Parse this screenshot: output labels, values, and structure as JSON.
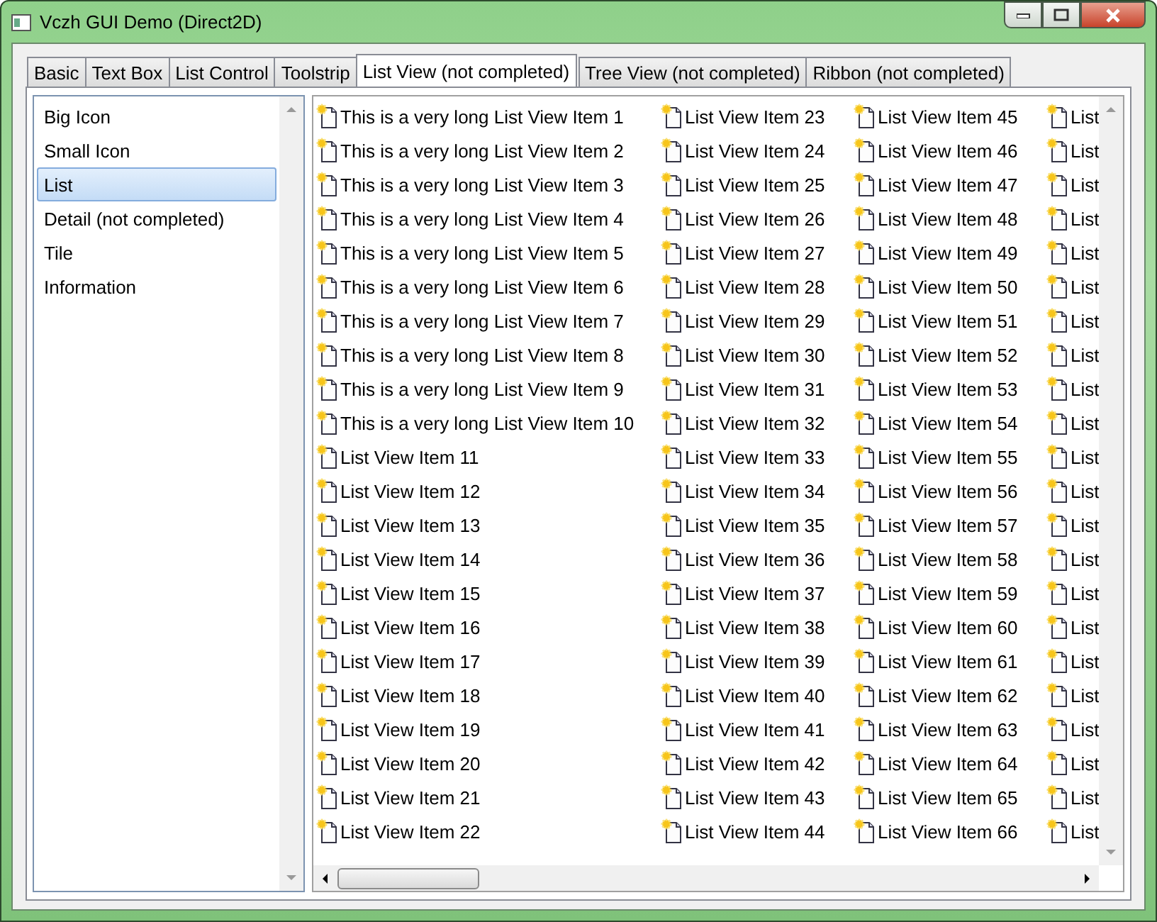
{
  "window": {
    "title": "Vczh GUI Demo (Direct2D)"
  },
  "tabs": [
    {
      "label": "Basic",
      "selected": false
    },
    {
      "label": "Text Box",
      "selected": false
    },
    {
      "label": "List Control",
      "selected": false
    },
    {
      "label": "Toolstrip",
      "selected": false
    },
    {
      "label": "List View (not completed)",
      "selected": true
    },
    {
      "label": "Tree View (not completed)",
      "selected": false
    },
    {
      "label": "Ribbon (not completed)",
      "selected": false
    }
  ],
  "view_modes": [
    {
      "label": "Big Icon",
      "selected": false
    },
    {
      "label": "Small Icon",
      "selected": false
    },
    {
      "label": "List",
      "selected": true
    },
    {
      "label": "Detail (not completed)",
      "selected": false
    },
    {
      "label": "Tile",
      "selected": false
    },
    {
      "label": "Information",
      "selected": false
    }
  ],
  "list_view": {
    "columns": [
      [
        "This is a very long List View Item 1",
        "This is a very long List View Item 2",
        "This is a very long List View Item 3",
        "This is a very long List View Item 4",
        "This is a very long List View Item 5",
        "This is a very long List View Item 6",
        "This is a very long List View Item 7",
        "This is a very long List View Item 8",
        "This is a very long List View Item 9",
        "This is a very long List View Item 10",
        "List View Item 11",
        "List View Item 12",
        "List View Item 13",
        "List View Item 14",
        "List View Item 15",
        "List View Item 16",
        "List View Item 17",
        "List View Item 18",
        "List View Item 19",
        "List View Item 20",
        "List View Item 21",
        "List View Item 22"
      ],
      [
        "List View Item 23",
        "List View Item 24",
        "List View Item 25",
        "List View Item 26",
        "List View Item 27",
        "List View Item 28",
        "List View Item 29",
        "List View Item 30",
        "List View Item 31",
        "List View Item 32",
        "List View Item 33",
        "List View Item 34",
        "List View Item 35",
        "List View Item 36",
        "List View Item 37",
        "List View Item 38",
        "List View Item 39",
        "List View Item 40",
        "List View Item 41",
        "List View Item 42",
        "List View Item 43",
        "List View Item 44"
      ],
      [
        "List View Item 45",
        "List View Item 46",
        "List View Item 47",
        "List View Item 48",
        "List View Item 49",
        "List View Item 50",
        "List View Item 51",
        "List View Item 52",
        "List View Item 53",
        "List View Item 54",
        "List View Item 55",
        "List View Item 56",
        "List View Item 57",
        "List View Item 58",
        "List View Item 59",
        "List View Item 60",
        "List View Item 61",
        "List View Item 62",
        "List View Item 63",
        "List View Item 64",
        "List View Item 65",
        "List View Item 66"
      ],
      [
        "List",
        "List",
        "List",
        "List",
        "List",
        "List",
        "List",
        "List",
        "List",
        "List",
        "List",
        "List",
        "List",
        "List",
        "List",
        "List",
        "List",
        "List",
        "List",
        "List",
        "List",
        "List"
      ]
    ]
  }
}
